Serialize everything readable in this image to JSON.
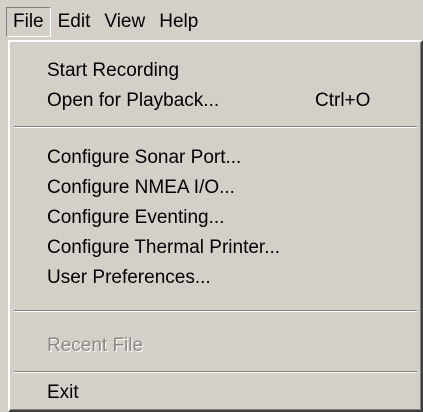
{
  "menubar": {
    "items": [
      {
        "label": "File"
      },
      {
        "label": "Edit"
      },
      {
        "label": "View"
      },
      {
        "label": "Help"
      }
    ]
  },
  "file_menu": {
    "start_recording": "Start Recording",
    "open_playback": "Open for Playback...",
    "open_playback_shortcut": "Ctrl+O",
    "configure_sonar_port": "Configure Sonar Port...",
    "configure_nmea": "Configure NMEA I/O...",
    "configure_eventing": "Configure Eventing...",
    "configure_thermal_printer": "Configure Thermal Printer...",
    "user_preferences": "User Preferences...",
    "recent_file": "Recent File",
    "exit": "Exit"
  },
  "colors": {
    "face": "#d4d0c8",
    "disabled_text": "#8c8a84"
  }
}
